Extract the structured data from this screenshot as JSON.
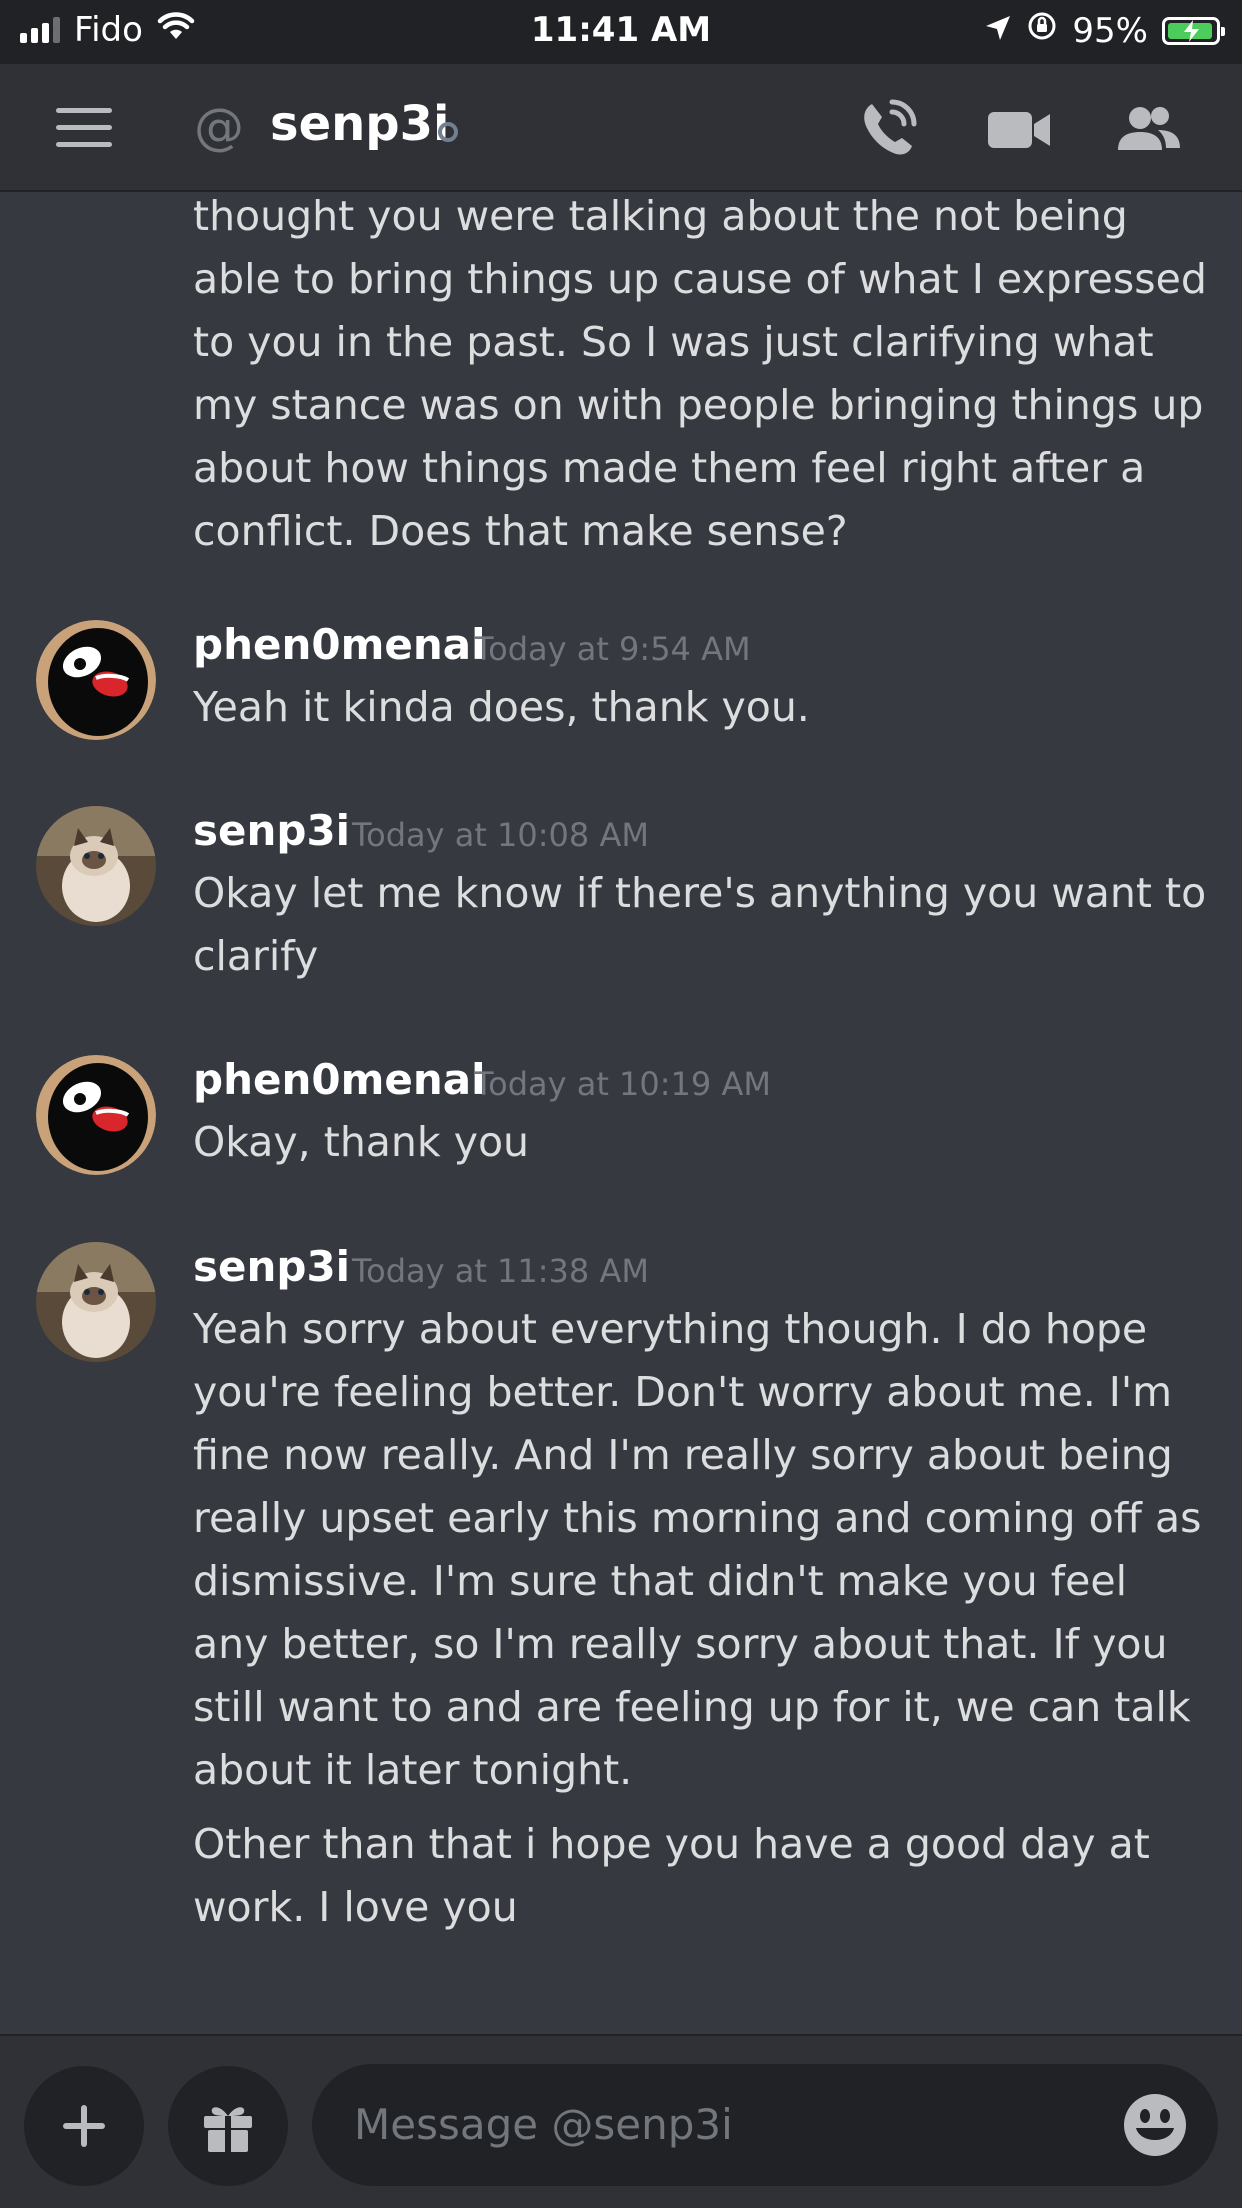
{
  "status_bar": {
    "carrier": "Fido",
    "time": "11:41 AM",
    "battery": "95%",
    "battery_level": 0.95
  },
  "header": {
    "title": "senp3i",
    "icons": [
      "hamburger-menu-icon",
      "at-icon",
      "phone-call-icon",
      "video-camera-icon",
      "members-icon"
    ]
  },
  "messages": {
    "continuation": {
      "text": "thought you were talking about the not being able to bring things up cause of what I expressed to you in the past. So I was just clarifying what my stance was on with people bringing things up about how things made them feel right after a conflict. Does that make sense?"
    },
    "groups": [
      {
        "author": "phen0menal",
        "timestamp": "Today at 9:54 AM",
        "texts": [
          "Yeah it kinda does, thank you."
        ]
      },
      {
        "author": "senp3i",
        "timestamp": "Today at 10:08 AM",
        "texts": [
          "Okay let me know if there's anything you want to clarify"
        ]
      },
      {
        "author": "phen0menal",
        "timestamp": "Today at 10:19 AM",
        "texts": [
          "Okay, thank you"
        ]
      },
      {
        "author": "senp3i",
        "timestamp": "Today at 11:38 AM",
        "texts": [
          "Yeah sorry about everything though. I do hope you're feeling better. Don't worry about me. I'm fine now really. And I'm really sorry about being really upset early this morning and coming off as dismissive. I'm sure that didn't make you feel any better, so I'm really sorry about that. If you still want to and are feeling up for it, we can talk about it later tonight.",
          "Other than that i hope you have a good day at work. I love you"
        ]
      }
    ]
  },
  "composer": {
    "placeholder": "Message @senp3i",
    "icons": [
      "plus-icon",
      "gift-icon",
      "emoji-icon"
    ]
  },
  "colors": {
    "background": "#36393f",
    "header_bg": "#2f3136",
    "input_bg": "#202225",
    "text": "#dcddde",
    "muted": "#72767d",
    "battery_green": "#4ccd5b"
  }
}
